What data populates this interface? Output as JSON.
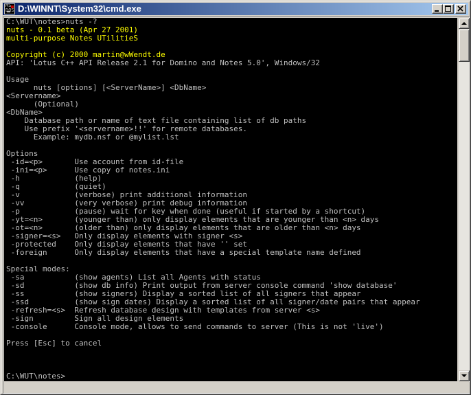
{
  "window": {
    "title": "D:\\WINNT\\System32\\cmd.exe",
    "icon": "cmd-icon",
    "icon_glyph": "MS\nDOS",
    "titlebar_color_start": "#0a246a",
    "titlebar_color_end": "#a6caf0",
    "buttons": [
      "minimize-icon",
      "maximize-icon",
      "close-icon"
    ]
  },
  "console": {
    "background": "#000000",
    "text_color": "#c0c0c0",
    "highlight_color": "#ffff00",
    "lines": [
      {
        "text": "C:\\WUT\\notes>nuts -?",
        "color": "default"
      },
      {
        "text": "nuts - 0.1 beta (Apr 27 2001)",
        "color": "yellow"
      },
      {
        "text": "multi-purpose Notes UTilitieS",
        "color": "yellow"
      },
      {
        "text": "",
        "color": "default"
      },
      {
        "text": "Copyright (c) 2000 martin@wWendt.de",
        "color": "yellow"
      },
      {
        "text": "API: 'Lotus C++ API Release 2.1 for Domino and Notes 5.0', Windows/32",
        "color": "default"
      },
      {
        "text": "",
        "color": "default"
      },
      {
        "text": "Usage",
        "color": "default"
      },
      {
        "text": "      nuts [options] [<ServerName>] <DbName>",
        "color": "default"
      },
      {
        "text": "<Servername>",
        "color": "default"
      },
      {
        "text": "      (Optional)",
        "color": "default"
      },
      {
        "text": "<DbName>",
        "color": "default"
      },
      {
        "text": "    Database path or name of text file containing list of db paths",
        "color": "default"
      },
      {
        "text": "    Use prefix '<servername>!!' for remote databases.",
        "color": "default"
      },
      {
        "text": "      Example: mydb.nsf or @mylist.lst",
        "color": "default"
      },
      {
        "text": "",
        "color": "default"
      },
      {
        "text": "Options",
        "color": "default"
      },
      {
        "text": " -id=<p>       Use account from id-file",
        "color": "default"
      },
      {
        "text": " -ini=<p>      Use copy of notes.ini",
        "color": "default"
      },
      {
        "text": " -h            (help)",
        "color": "default"
      },
      {
        "text": " -q            (quiet)",
        "color": "default"
      },
      {
        "text": " -v            (verbose) print additional information",
        "color": "default"
      },
      {
        "text": " -vv           (very verbose) print debug information",
        "color": "default"
      },
      {
        "text": " -p            (pause) wait for key when done (useful if started by a shortcut)",
        "color": "default"
      },
      {
        "text": " -yt=<n>       (younger than) only display elements that are younger than <n> days",
        "color": "default"
      },
      {
        "text": " -ot=<n>       (older than) only display elements that are older than <n> days",
        "color": "default"
      },
      {
        "text": " -signer=<s>   Only display elements with signer <s>",
        "color": "default"
      },
      {
        "text": " -protected    Only display elements that have '' set",
        "color": "default"
      },
      {
        "text": " -foreign      Only display elements that have a special template name defined",
        "color": "default"
      },
      {
        "text": "",
        "color": "default"
      },
      {
        "text": "Special modes:",
        "color": "default"
      },
      {
        "text": " -sa           (show agents) List all Agents with status",
        "color": "default"
      },
      {
        "text": " -sd           (show db info) Print output from server console command 'show database'",
        "color": "default"
      },
      {
        "text": " -ss           (show signers) Display a sorted list of all signers that appear",
        "color": "default"
      },
      {
        "text": " -ssd          (show sign dates) Display a sorted list of all signer/date pairs that appear",
        "color": "default"
      },
      {
        "text": " -refresh=<s>  Refresh database design with templates from server <s>",
        "color": "default"
      },
      {
        "text": " -sign         Sign all design elements",
        "color": "default"
      },
      {
        "text": " -console      Console mode, allows to send commands to server (This is not 'live')",
        "color": "default"
      },
      {
        "text": "",
        "color": "default"
      },
      {
        "text": "Press [Esc] to cancel",
        "color": "default"
      },
      {
        "text": "",
        "color": "default"
      },
      {
        "text": "",
        "color": "default"
      },
      {
        "text": "",
        "color": "default"
      },
      {
        "text": "C:\\WUT\\notes>",
        "color": "default"
      }
    ]
  },
  "scrollbar": {
    "up_icon": "arrow-up-icon",
    "down_icon": "arrow-down-icon"
  }
}
